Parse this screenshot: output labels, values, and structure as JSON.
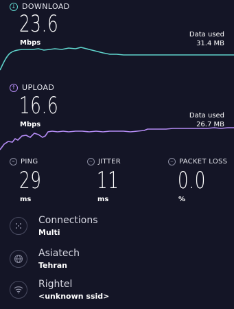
{
  "download": {
    "label": "DOWNLOAD",
    "value": "23.6",
    "unit": "Mbps",
    "data_used_label": "Data used",
    "data_used_value": "31.4 MB",
    "color": "#5fd3cb",
    "icon": "arrow-down-circle-icon"
  },
  "upload": {
    "label": "UPLOAD",
    "value": "16.6",
    "unit": "Mbps",
    "data_used_label": "Data used",
    "data_used_value": "26.7 MB",
    "color": "#b58cf5",
    "icon": "arrow-up-circle-icon"
  },
  "metrics": {
    "ping": {
      "label": "PING",
      "value": "29",
      "unit": "ms"
    },
    "jitter": {
      "label": "JITTER",
      "value": "11",
      "unit": "ms"
    },
    "packet_loss": {
      "label": "PACKET LOSS",
      "value": "0.0",
      "unit": "%"
    }
  },
  "info": {
    "connections": {
      "title": "Connections",
      "value": "Multi",
      "icon": "connections-icon"
    },
    "provider": {
      "title": "Asiatech",
      "value": "Tehran",
      "icon": "globe-icon"
    },
    "network": {
      "title": "Rightel",
      "value": "<unknown ssid>",
      "icon": "wifi-icon"
    }
  },
  "colors": {
    "background": "#141526",
    "download_line": "#5fd3cb",
    "upload_line": "#b58cf5"
  }
}
